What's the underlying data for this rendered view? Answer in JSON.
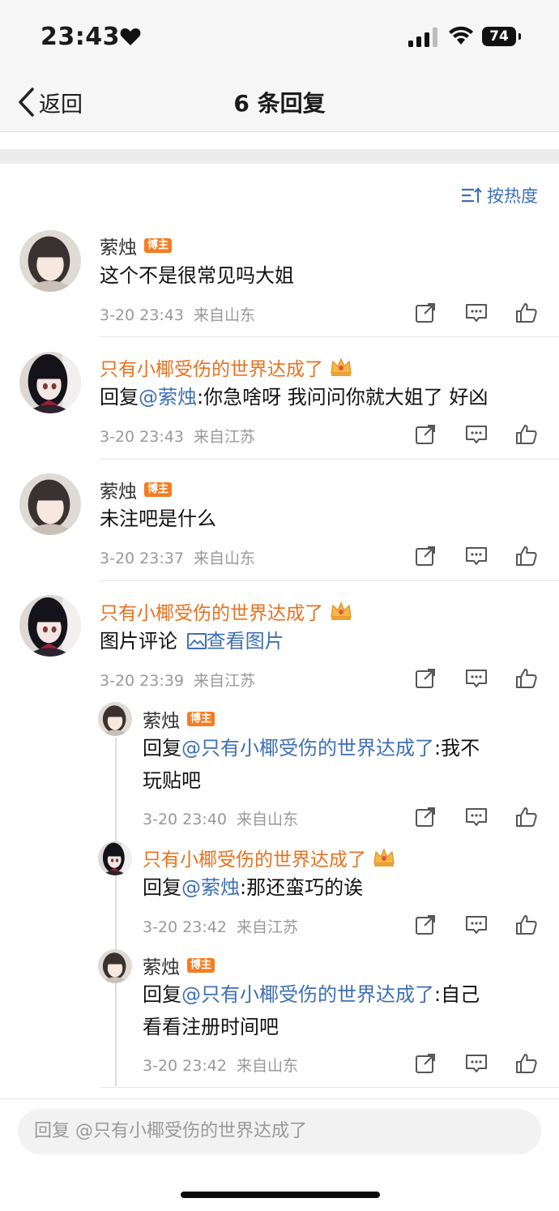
{
  "status": {
    "time": "23:43",
    "battery": "74"
  },
  "nav": {
    "back_label": "返回",
    "title": "6 条回复"
  },
  "sort_label": "按热度",
  "blogger_badge": "博主",
  "reply_prefix": "回复",
  "comments": [
    {
      "user": "萦烛",
      "text": "这个不是很常见吗大姐",
      "time": "3-20 23:43",
      "location": "来自山东"
    },
    {
      "user": "只有小椰受伤的世界达成了",
      "mention": "@萦烛",
      "text": ":你急啥呀 我问问你就大姐了 好凶",
      "time": "3-20 23:43",
      "location": "来自江苏"
    },
    {
      "user": "萦烛",
      "text": "未注吧是什么",
      "time": "3-20 23:37",
      "location": "来自山东"
    },
    {
      "user": "只有小椰受伤的世界达成了",
      "text": "图片评论",
      "link": "查看图片",
      "time": "3-20 23:39",
      "location": "来自江苏"
    }
  ],
  "replies": [
    {
      "user": "萦烛",
      "mention": "@只有小椰受伤的世界达成了",
      "text_line1": ":我不",
      "text_line2": "玩贴吧",
      "time": "3-20 23:40",
      "location": "来自山东"
    },
    {
      "user": "只有小椰受伤的世界达成了",
      "mention": "@萦烛",
      "text": ":那还蛮巧的诶",
      "time": "3-20 23:42",
      "location": "来自江苏"
    },
    {
      "user": "萦烛",
      "mention": "@只有小椰受伤的世界达成了",
      "text_line1": ":自己",
      "text_line2": "看看注册时间吧",
      "time": "3-20 23:42",
      "location": "来自山东"
    }
  ],
  "footer": {
    "reply_placeholder": "回复 @只有小椰受伤的世界达成了"
  },
  "colors": {
    "username_highlight": "#e8711e",
    "mention": "#3d6fb4",
    "badge": "#f47d21"
  }
}
